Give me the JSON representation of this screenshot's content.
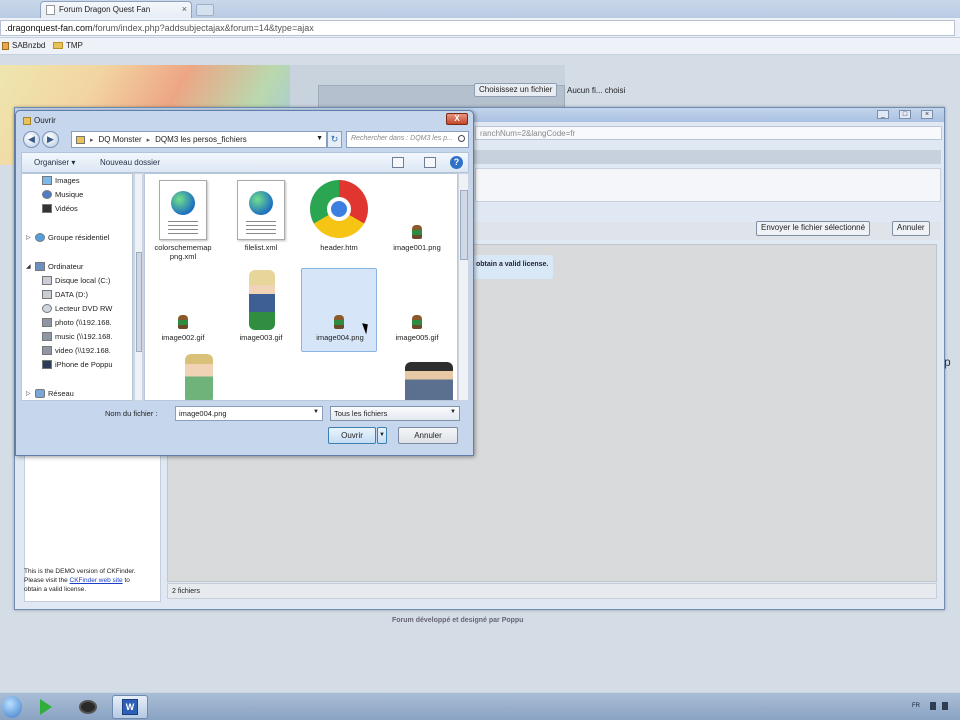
{
  "browser": {
    "tab_title": "Forum Dragon Quest Fan",
    "address_host": ".dragonquest-fan.com",
    "address_path": "/forum/index.php?addsubjectajax&forum=14&type=ajax",
    "bookmarks": [
      "SABnzbd",
      "TMP"
    ]
  },
  "ckfinder": {
    "url_text": "ranchNum=2&langCode=fr",
    "choose_button": "Choisissez un fichier",
    "no_file_text": "Aucun fi... choisi",
    "send_button": "Envoyer le fichier sélectionné",
    "cancel_button": "Annuler",
    "license_tip": "obtain a valid license.",
    "demo_line1": "This is the DEMO version of CKFinder.",
    "demo_line2_pre": "Please visit the",
    "demo_link": "CKFinder web site",
    "demo_line2_post": "to",
    "demo_line3": "obtain a valid license.",
    "status": "2 fichiers"
  },
  "page": {
    "footer": "Forum développé et designé par Poppu",
    "edge_text": "p"
  },
  "dialog": {
    "title": "Ouvrir",
    "close_label": "X",
    "breadcrumb": [
      "DQ Monster",
      "DQM3  les persos_fichiers"
    ],
    "search_placeholder": "Rechercher dans : DQM3  les p...",
    "toolbar": {
      "organize": "Organiser ▾",
      "new_folder": "Nouveau dossier"
    },
    "nav_items": [
      {
        "label": "Images",
        "icon": "pictures-icon"
      },
      {
        "label": "Musique",
        "icon": "music-icon"
      },
      {
        "label": "Vidéos",
        "icon": "videos-icon"
      },
      {
        "label": "Groupe résidentiel",
        "icon": "homegroup-icon"
      },
      {
        "label": "Ordinateur",
        "icon": "computer-icon"
      },
      {
        "label": "Disque local (C:)",
        "icon": "drive-icon"
      },
      {
        "label": "DATA (D:)",
        "icon": "drive-icon"
      },
      {
        "label": "Lecteur DVD RW",
        "icon": "dvd-icon"
      },
      {
        "label": "photo (\\\\192.168.",
        "icon": "network-drive-icon"
      },
      {
        "label": "music (\\\\192.168.",
        "icon": "network-drive-icon"
      },
      {
        "label": "video (\\\\192.168.",
        "icon": "network-drive-icon"
      },
      {
        "label": "iPhone de Poppu",
        "icon": "phone-icon"
      },
      {
        "label": "Réseau",
        "icon": "network-icon"
      }
    ],
    "files": [
      {
        "name": "colorschememap\npng.xml",
        "icon": "xml-globe-icon"
      },
      {
        "name": "filelist.xml",
        "icon": "xml-globe-icon"
      },
      {
        "name": "header.htm",
        "icon": "chrome-icon"
      },
      {
        "name": "image001.png",
        "icon": "sprite-icon"
      },
      {
        "name": "image002.gif",
        "icon": "sprite-icon"
      },
      {
        "name": "image003.gif",
        "icon": "character-icon"
      },
      {
        "name": "image004.png",
        "icon": "sprite-icon",
        "selected": true
      },
      {
        "name": "image005.gif",
        "icon": "sprite-icon"
      }
    ],
    "filename_label": "Nom du fichier :",
    "filename_value": "image004.png",
    "filetype_value": "Tous les fichiers",
    "open_button": "Ouvrir",
    "cancel_button": "Annuler"
  },
  "taskbar": {
    "lang": "FR",
    "apps": [
      "media-player-icon",
      "disc-icon",
      "word-icon"
    ]
  },
  "colors": {
    "dialog_bg": "#c6d6ec",
    "selection": "#d6e6f8",
    "link": "#1a3fc9"
  }
}
